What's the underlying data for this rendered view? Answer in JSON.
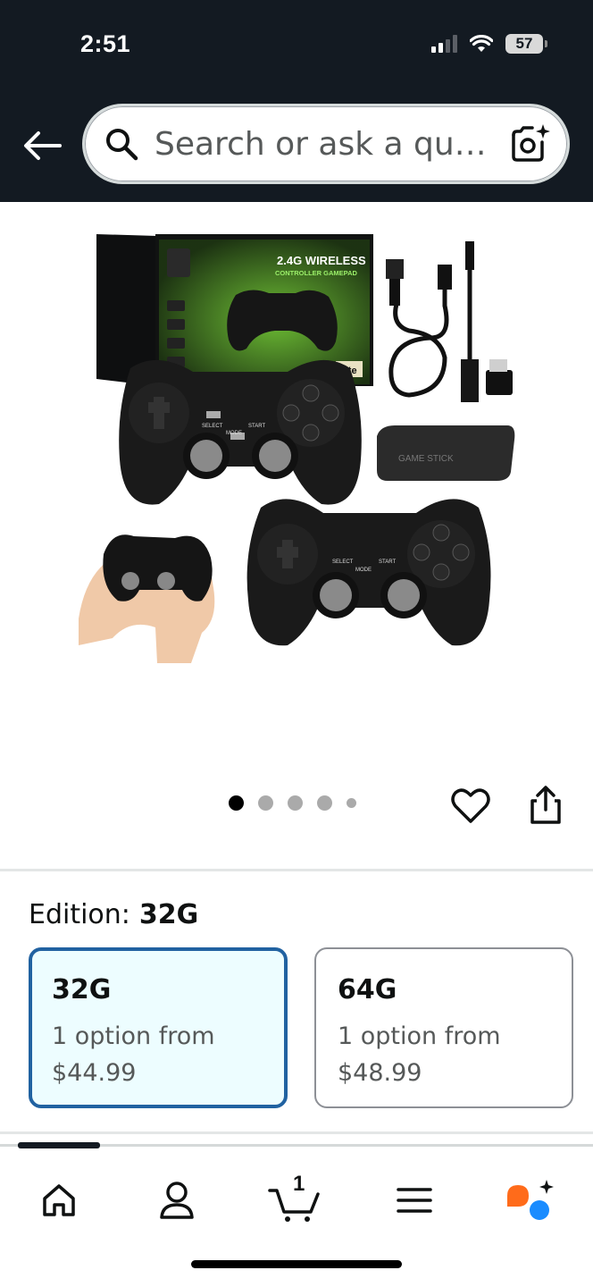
{
  "status_bar": {
    "time": "2:51",
    "battery": "57"
  },
  "search": {
    "placeholder": "Search or ask a qu…"
  },
  "product": {
    "image_texts": {
      "box_title_line1": "2.4G WIRELESS",
      "box_title_line2": "CONTROLLER GAMEPAD",
      "box_badge": "Lite",
      "stick_label": "GAME STICK",
      "btn_select": "SELECT",
      "btn_start": "START",
      "btn_mode": "MODE"
    },
    "carousel": {
      "total": 5,
      "active_index": 0
    }
  },
  "edition": {
    "label": "Edition:",
    "selected_value": "32G",
    "options": [
      {
        "name": "32G",
        "line1": "1 option from",
        "price": "$44.99",
        "selected": true
      },
      {
        "name": "64G",
        "line1": "1 option from",
        "price": "$48.99",
        "selected": false
      }
    ]
  },
  "bottom_nav": {
    "items": [
      {
        "icon": "home-icon"
      },
      {
        "icon": "account-icon"
      },
      {
        "icon": "cart-icon",
        "count": "1"
      },
      {
        "icon": "menu-icon"
      },
      {
        "icon": "rufus-assistant-icon"
      }
    ]
  },
  "colors": {
    "header_bg": "#131a22",
    "selected_border": "#2162a1",
    "selected_bg": "#edfdff",
    "assistant_orange": "#ff6b1a",
    "assistant_blue": "#1a8cff"
  }
}
